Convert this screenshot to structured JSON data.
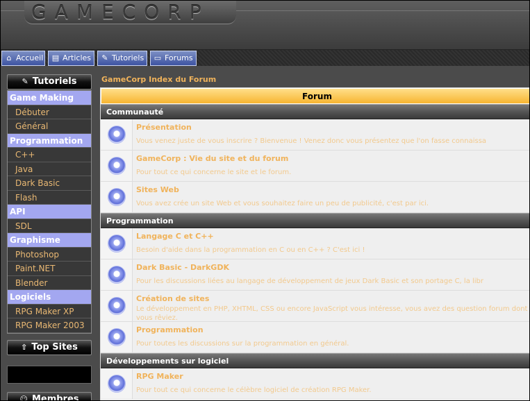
{
  "header": {
    "logo": "GAMECORP"
  },
  "nav": [
    {
      "label": "Accueil",
      "icon": "home-icon"
    },
    {
      "label": "Articles",
      "icon": "document-icon"
    },
    {
      "label": "Tutoriels",
      "icon": "pencil-icon"
    },
    {
      "label": "Forums",
      "icon": "speech-bubble-icon"
    }
  ],
  "sidebar": {
    "tutoriels_title": "Tutoriels",
    "menu": [
      {
        "type": "cat",
        "label": "Game Making"
      },
      {
        "type": "item",
        "label": "Débuter"
      },
      {
        "type": "item",
        "label": "Général"
      },
      {
        "type": "cat",
        "label": "Programmation"
      },
      {
        "type": "item",
        "label": "C++"
      },
      {
        "type": "item",
        "label": "Java"
      },
      {
        "type": "item",
        "label": "Dark Basic"
      },
      {
        "type": "item",
        "label": "Flash"
      },
      {
        "type": "cat",
        "label": "API"
      },
      {
        "type": "item",
        "label": "SDL"
      },
      {
        "type": "cat",
        "label": "Graphisme"
      },
      {
        "type": "item",
        "label": "Photoshop"
      },
      {
        "type": "item",
        "label": "Paint.NET"
      },
      {
        "type": "item",
        "label": "Blender"
      },
      {
        "type": "cat",
        "label": "Logiciels"
      },
      {
        "type": "item",
        "label": "RPG Maker XP"
      },
      {
        "type": "item",
        "label": "RPG Maker 2003"
      }
    ],
    "top_sites_title": "Top Sites",
    "membres_title": "Membres"
  },
  "main": {
    "breadcrumb": "GameCorp Index du Forum",
    "forum_header": "Forum",
    "categories": [
      {
        "name": "Communauté",
        "forums": [
          {
            "title": "Présentation",
            "desc": "Vous venez juste de vous inscrire ? Bienvenue ! Venez donc vous présentez que l'on fasse connaissa"
          },
          {
            "title": "GameCorp : Vie du site et du forum",
            "desc": "Pour tout ce qui concerne le site et le forum."
          },
          {
            "title": "Sites Web",
            "desc": "Vous avez crée un site Web et vous souhaitez faire un peu de publicité, c'est par ici."
          }
        ]
      },
      {
        "name": "Programmation",
        "forums": [
          {
            "title": "Langage C et C++",
            "desc": "Besoin d'aide dans la programmation en C ou en C++ ? C'est ici !"
          },
          {
            "title": "Dark Basic - DarkGDK",
            "desc": "Pour les discussions liées au langage de développement de jeux Dark Basic et son portage C, la libr"
          },
          {
            "title": "Création de sites",
            "desc": "Le développement en PHP, XHTML, CSS ou encore JavaScript vous intéresse, vous avez des question forum dont vous rêviez."
          },
          {
            "title": "Programmation",
            "desc": "Pour toutes les discussions sur la programmation en général."
          }
        ]
      },
      {
        "name": "Développements sur logiciel",
        "forums": [
          {
            "title": "RPG Maker",
            "desc": "Pour tout ce qui concerne le célèbre logiciel de création RPG Maker."
          }
        ]
      }
    ]
  }
}
